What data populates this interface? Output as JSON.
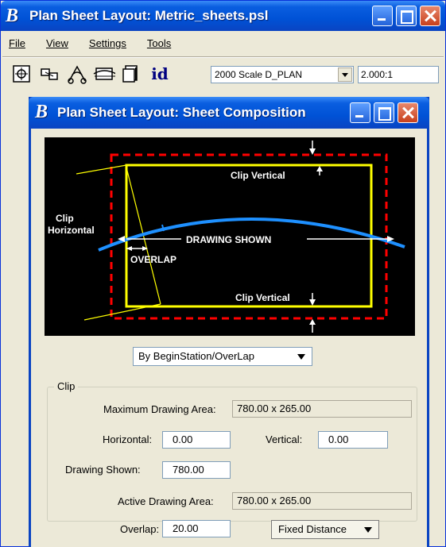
{
  "outer": {
    "title": "Plan Sheet Layout: Metric_sheets.psl",
    "menu": [
      "File",
      "View",
      "Settings",
      "Tools"
    ],
    "toolbar": {
      "icons": [
        "target-icon",
        "sheets-icon",
        "cut-icon",
        "rectangle-icon",
        "copy-icon",
        "id-icon"
      ],
      "id_label": "id",
      "scale_value": "2000 Scale D_PLAN",
      "ratio_value": "2.000:1"
    }
  },
  "inner": {
    "title": "Plan Sheet Layout: Sheet Composition",
    "diagram": {
      "clip_vertical_top": "Clip Vertical",
      "clip_vertical_bottom": "Clip Vertical",
      "clip_horizontal_line1": "Clip",
      "clip_horizontal_line2": "Horizontal",
      "drawing_shown": "DRAWING SHOWN",
      "overlap": "OVERLAP"
    },
    "method": "By BeginStation/OverLap",
    "clip_group": {
      "legend": "Clip",
      "max_area_label": "Maximum Drawing Area:",
      "max_area_value": "780.00 x  265.00",
      "horizontal_label": "Horizontal:",
      "horizontal_value": "0.00",
      "vertical_label": "Vertical:",
      "vertical_value": "0.00",
      "drawing_shown_label": "Drawing Shown:",
      "drawing_shown_value": "780.00",
      "active_area_label": "Active Drawing Area:",
      "active_area_value": "780.00 x  265.00"
    },
    "overlap_label": "Overlap:",
    "overlap_value": "20.00",
    "overlap_mode": "Fixed Distance"
  },
  "colors": {
    "title_blue": "#0a5ee0",
    "clip_red": "#ff0000",
    "sheet_yellow": "#ffff00",
    "alignment_cyan": "#1e90ff"
  }
}
